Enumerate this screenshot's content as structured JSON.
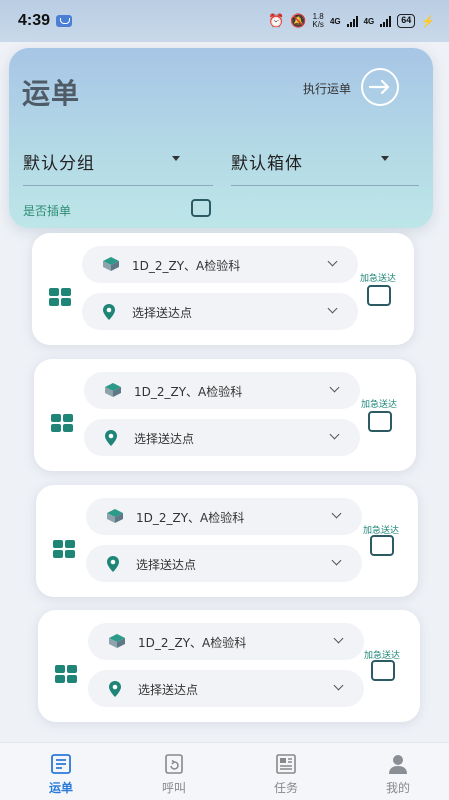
{
  "status_bar": {
    "time": "4:39",
    "speed_value": "1.8",
    "speed_unit": "K/s",
    "net1": "4G",
    "net2": "4G",
    "battery": "64"
  },
  "header": {
    "title": "运单",
    "execute_label": "执行运单",
    "default_group": "默认分组",
    "default_box": "默认箱体",
    "insert_label": "是否插单"
  },
  "orders": [
    {
      "department": "1D_2_ZY、A检验科",
      "destination": "选择送达点",
      "urgent_label": "加急送达"
    },
    {
      "department": "1D_2_ZY、A检验科",
      "destination": "选择送达点",
      "urgent_label": "加急送达"
    },
    {
      "department": "1D_2_ZY、A检验科",
      "destination": "选择送达点",
      "urgent_label": "加急送达"
    },
    {
      "department": "1D_2_ZY、A检验科",
      "destination": "选择送达点",
      "urgent_label": "加急送达"
    }
  ],
  "nav": {
    "items": [
      {
        "label": "运单",
        "icon": "waybill-icon",
        "active": true
      },
      {
        "label": "呼叫",
        "icon": "call-icon",
        "active": false
      },
      {
        "label": "任务",
        "icon": "task-icon",
        "active": false
      },
      {
        "label": "我的",
        "icon": "profile-icon",
        "active": false
      }
    ]
  },
  "colors": {
    "accent": "#1e8577",
    "header_top": "#a7c5e6",
    "header_bottom": "#bde6e8",
    "nav_active": "#2a7ad8"
  }
}
